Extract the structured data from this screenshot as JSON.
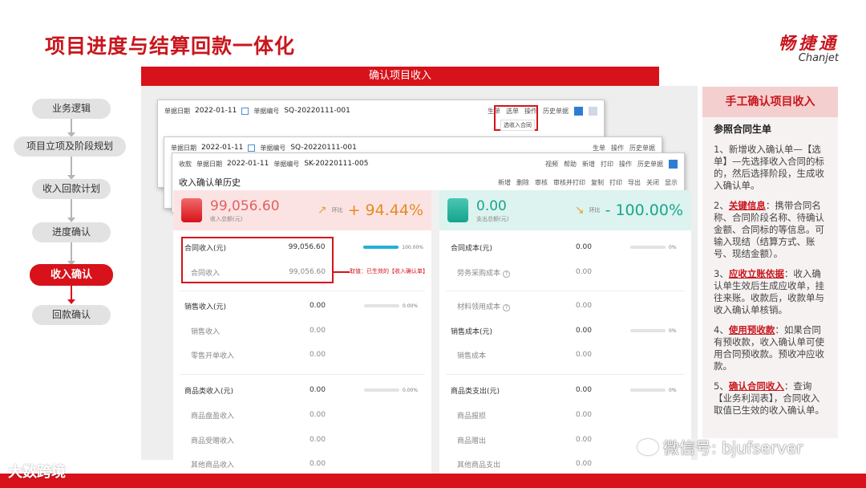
{
  "slide": {
    "title": "项目进度与结算回款一体化",
    "brand_cn": "畅捷通",
    "brand_en": "Chanjet"
  },
  "top_bar": "确认项目收入",
  "flow": [
    "业务逻辑",
    "项目立项及阶段规划",
    "收入回款计划",
    "进度确认",
    "收入确认",
    "回款确认"
  ],
  "windows": {
    "back1": {
      "date_label": "单据日期",
      "date": "2022-01-11",
      "code_label": "单据编号",
      "code": "SQ-20220111-001",
      "tools": [
        "生单",
        "选单",
        "操作",
        "历史单据"
      ],
      "popup": "选收入合同"
    },
    "back2": {
      "date_label": "单据日期",
      "date": "2022-01-11",
      "code_label": "单据编号",
      "code": "SQ-20220111-001",
      "tools": [
        "生单",
        "操作",
        "历史单据"
      ]
    },
    "front": {
      "tab": "收款",
      "date_label": "单据日期",
      "date": "2022-01-11",
      "code_label": "单据编号",
      "code": "SK-20220111-005",
      "tools": [
        "视频",
        "帮助",
        "新增",
        "打印",
        "操作",
        "历史单据"
      ],
      "subtitle": "收入确认单历史",
      "toolbar": [
        "新增",
        "删除",
        "审核",
        "审核并打印",
        "复制",
        "打印",
        "导出",
        "关闭",
        "显示"
      ]
    }
  },
  "income": {
    "total": "99,056.60",
    "total_label": "收入总额(元)",
    "trend_label": "环比",
    "trend": "+ 94.44%",
    "rows": [
      {
        "name": "合同收入(元)",
        "amount": "99,056.60",
        "pct": "100.00%",
        "fill": 1.0
      },
      {
        "name": "合同收入",
        "amount": "99,056.60",
        "sub": true
      },
      {
        "name": "销售收入(元)",
        "amount": "0.00",
        "pct": "0.00%",
        "fill": 0
      },
      {
        "name": "销售收入",
        "amount": "0.00",
        "sub": true
      },
      {
        "name": "零售开单收入",
        "amount": "0.00",
        "sub": true
      },
      {
        "name": "商品类收入(元)",
        "amount": "0.00",
        "pct": "0.00%",
        "fill": 0
      },
      {
        "name": "商品盘盈收入",
        "amount": "0.00",
        "sub": true
      },
      {
        "name": "商品受赠收入",
        "amount": "0.00",
        "sub": true
      },
      {
        "name": "其他商品收入",
        "amount": "0.00",
        "sub": true
      }
    ]
  },
  "expense": {
    "total": "0.00",
    "total_label": "支出总额(元)",
    "trend_label": "环比",
    "trend": "- 100.00%",
    "rows": [
      {
        "name": "合同成本(元)",
        "amount": "0.00",
        "pct": "0%",
        "fill": 0
      },
      {
        "name": "劳务采购成本",
        "amount": "0.00",
        "sub": true,
        "q": true
      },
      {
        "name": "材料领用成本",
        "amount": "0.00",
        "sub": true,
        "q": true
      },
      {
        "name": "销售成本(元)",
        "amount": "0.00",
        "pct": "0%",
        "fill": 0
      },
      {
        "name": "销售成本",
        "amount": "0.00",
        "sub": true
      },
      {
        "name": "商品类支出(元)",
        "amount": "0.00",
        "pct": "0%",
        "fill": 0
      },
      {
        "name": "商品报损",
        "amount": "0.00",
        "sub": true
      },
      {
        "name": "商品赠出",
        "amount": "0.00",
        "sub": true
      },
      {
        "name": "其他商品支出",
        "amount": "0.00",
        "sub": true
      }
    ]
  },
  "annotation": "取值：已生效的【收入确认单】",
  "info": {
    "header": "手工确认项目收入",
    "title": "参照合同生单",
    "p1": "1、新增收入确认单—【选单】—先选择收入合同的标的，然后选择阶段，生成收入确认单。",
    "p2_kw": "关键信息",
    "p2": "：携带合同名称、合同阶段名称、待确认金额、合同标的等信息。可输入现结（结算方式、账号、现结金额）。",
    "p3_kw": "应收立账依据",
    "p3": "：收入确认单生效后生成应收单，挂往来账。收款后，收款单与收入确认单核销。",
    "p4_kw": "使用预收款",
    "p4": "：如果合同有预收款，收入确认单可使用合同预收款。预收冲应收款。",
    "p5_kw": "确认合同收入",
    "p5": "：查询【业务利润表】，合同收入取值已生效的收入确认单。"
  },
  "watermark": {
    "left": "大数跨境",
    "right": "微信号: bjufserver"
  },
  "colors": {
    "brand_red": "#d7121a",
    "income_pink": "#fce3e3",
    "expense_mint": "#dcf3ef",
    "progress": "#22b0d6"
  }
}
